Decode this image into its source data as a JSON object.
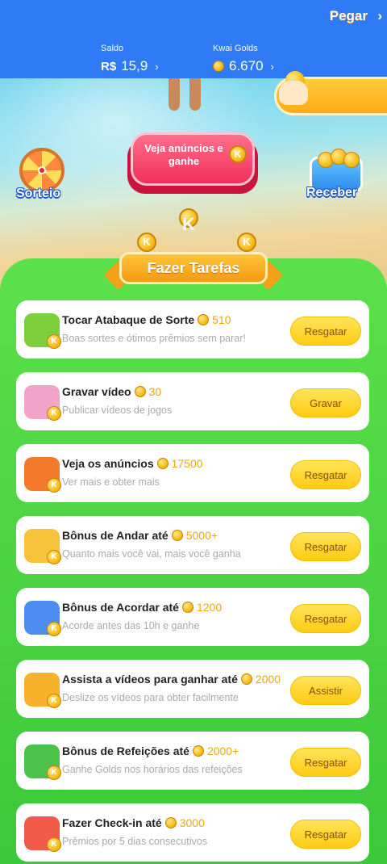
{
  "header": {
    "saldo_label": "Saldo",
    "saldo_currency": "R$",
    "saldo_value": "15,9",
    "golds_label": "Kwai Golds",
    "golds_value": "6.670",
    "chevron": "›"
  },
  "scene": {
    "pegar_label": "Pegar",
    "pegar_chevron": "›",
    "main_button_label": "Veja anúncios e ganhe",
    "sorteio_label": "Sorteio",
    "receber_label": "Receber"
  },
  "tasks_section": {
    "title": "Fazer Tarefas",
    "coin_letter": "K"
  },
  "tasks": [
    {
      "title": "Tocar Atabaque de Sorte",
      "reward": "510",
      "subtitle": "Boas sortes e ótimos prêmios sem parar!",
      "button": "Resgatar",
      "icon": "drum-icon",
      "icon_color": "#7ccf3a"
    },
    {
      "title": "Gravar vídeo",
      "reward": "30",
      "subtitle": "Publicar vídeos de jogos",
      "button": "Gravar",
      "icon": "game-controller-icon",
      "icon_color": "#f2a4c8"
    },
    {
      "title": "Veja os anúncios",
      "reward": "17500",
      "subtitle": "Ver mais e obter mais",
      "button": "Resgatar",
      "icon": "tv-icon",
      "icon_color": "#f27a2a"
    },
    {
      "title": "Bônus de Andar até",
      "reward": "5000+",
      "subtitle": "Quanto mais você vai, mais você ganha",
      "button": "Resgatar",
      "icon": "running-boy-icon",
      "icon_color": "#f5c23a"
    },
    {
      "title": "Bônus de Acordar até",
      "reward": "1200",
      "subtitle": "Acorde antes das 10h e ganhe",
      "button": "Resgatar",
      "icon": "moon-icon",
      "icon_color": "#4d8df2"
    },
    {
      "title": "Assista a vídeos para ganhar até",
      "reward": "2000",
      "subtitle": "Deslize os vídeos para obter facilmente",
      "button": "Assistir",
      "icon": "video-camera-icon",
      "icon_color": "#f5b22a"
    },
    {
      "title": "Bônus de Refeições até",
      "reward": "2000+",
      "subtitle": "Ganhe Golds nos horários das refeições",
      "button": "Resgatar",
      "icon": "meal-box-icon",
      "icon_color": "#4cc24a"
    },
    {
      "title": "Fazer Check-in até",
      "reward": "3000",
      "subtitle": "Prêmios por 5 dias consecutivos",
      "button": "Resgatar",
      "icon": "calendar-icon",
      "icon_color": "#f25a4a"
    }
  ],
  "coin_badge_letter": "K"
}
